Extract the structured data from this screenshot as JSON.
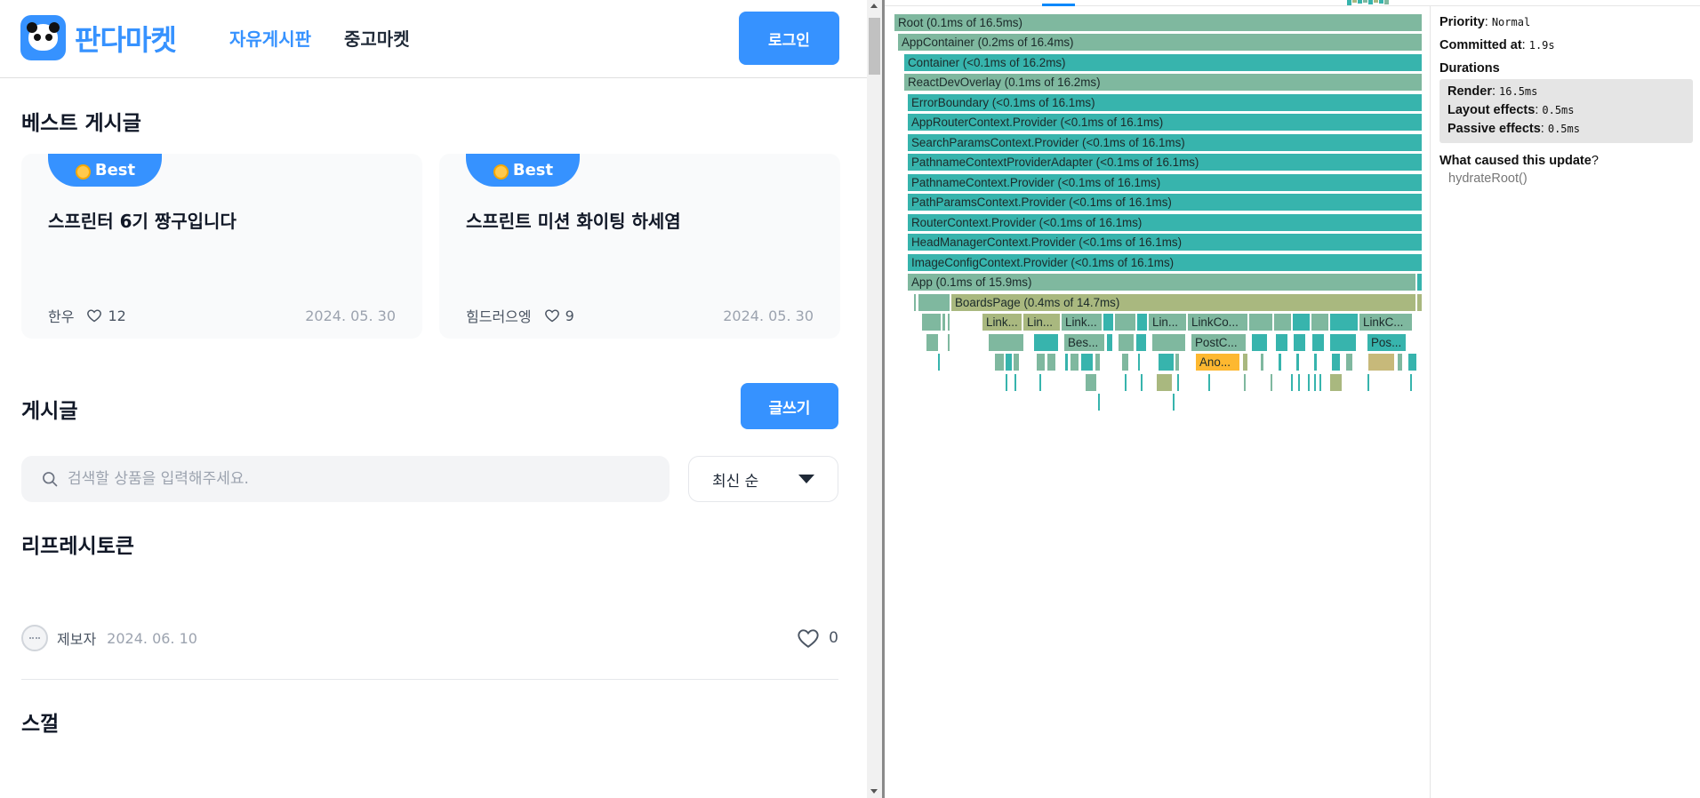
{
  "site": {
    "logo_text": "판다마켓",
    "nav": {
      "free_board": "자유게시판",
      "used_market": "중고마켓"
    },
    "login_button": "로그인",
    "best_section_title": "베스트 게시글",
    "best_posts": [
      {
        "badge": "Best",
        "title": "스프린터 6기 짱구입니다",
        "author": "한우",
        "likes": "12",
        "date": "2024. 05. 30"
      },
      {
        "badge": "Best",
        "title": "스프린트 미션 화이팅 하세염",
        "author": "힘드러으엥",
        "likes": "9",
        "date": "2024. 05. 30"
      }
    ],
    "posts_section_title": "게시글",
    "write_button": "글쓰기",
    "search_placeholder": "검색할 상품을 입력해주세요.",
    "sort_selected": "최신 순",
    "posts": [
      {
        "title": "리프레시토큰",
        "author": "제보자",
        "date": "2024. 06. 10",
        "likes": "0"
      },
      {
        "title": "스껄"
      }
    ]
  },
  "devtools": {
    "flame": [
      {
        "label": "Root (0.1ms of 16.5ms)",
        "color": "#7fb89f"
      },
      {
        "label": "AppContainer (0.2ms of 16.4ms)",
        "color": "#7fb89f"
      },
      {
        "label": "Container (<0.1ms of 16.2ms)",
        "color": "#37b4ad"
      },
      {
        "label": "ReactDevOverlay (0.1ms of 16.2ms)",
        "color": "#7fb89f"
      },
      {
        "label": "ErrorBoundary (<0.1ms of 16.1ms)",
        "color": "#37b4ad"
      },
      {
        "label": "AppRouterContext.Provider (<0.1ms of 16.1ms)",
        "color": "#37b4ad"
      },
      {
        "label": "SearchParamsContext.Provider (<0.1ms of 16.1ms)",
        "color": "#37b4ad"
      },
      {
        "label": "PathnameContextProviderAdapter (<0.1ms of 16.1ms)",
        "color": "#37b4ad"
      },
      {
        "label": "PathnameContext.Provider (<0.1ms of 16.1ms)",
        "color": "#37b4ad"
      },
      {
        "label": "PathParamsContext.Provider (<0.1ms of 16.1ms)",
        "color": "#37b4ad"
      },
      {
        "label": "RouterContext.Provider (<0.1ms of 16.1ms)",
        "color": "#37b4ad"
      },
      {
        "label": "HeadManagerContext.Provider (<0.1ms of 16.1ms)",
        "color": "#37b4ad"
      },
      {
        "label": "ImageConfigContext.Provider (<0.1ms of 16.1ms)",
        "color": "#37b4ad"
      },
      {
        "label": "App (0.1ms of 15.9ms)",
        "color": "#7fb89f"
      },
      {
        "label": "BoardsPage (0.4ms of 14.7ms)",
        "color": "#a9b87f"
      }
    ],
    "flame_small_labels": [
      "Link...",
      "Lin...",
      "Link...",
      "Lin...",
      "LinkCo...",
      "LinkC...",
      "Bes...",
      "PostC...",
      "Pos...",
      "Ano..."
    ],
    "details": {
      "priority_label": "Priority",
      "priority_value": "Normal",
      "committed_label": "Committed at",
      "committed_value": "1.9s",
      "durations_label": "Durations",
      "render_label": "Render",
      "render_value": "16.5ms",
      "layout_label": "Layout effects",
      "layout_value": "0.5ms",
      "passive_label": "Passive effects",
      "passive_value": "0.5ms",
      "cause_label": "What caused this update",
      "cause_value": "hydrateRoot()"
    }
  }
}
